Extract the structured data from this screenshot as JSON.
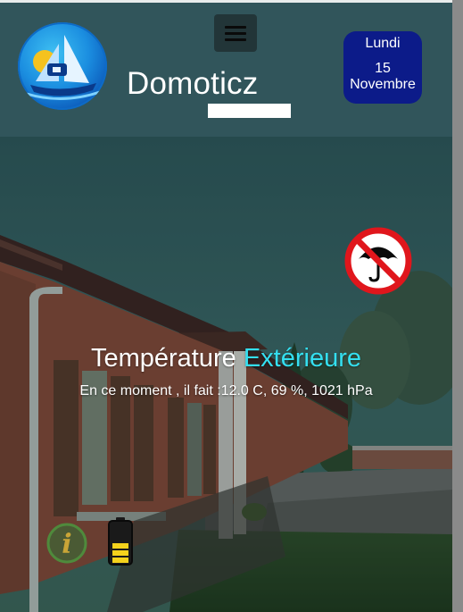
{
  "header": {
    "title": "Domoticz",
    "date": {
      "weekday": "Lundi",
      "day": "15",
      "month": "Novembre"
    }
  },
  "weather": {
    "title_main": "Température",
    "title_accent": "Extérieure",
    "current_line": "En ce moment , il fait :12.0 C, 69 %, 1021 hPa",
    "rain_status_icon": "no-rain-umbrella-icon"
  },
  "icons": {
    "logo": "domoticz-sailboat-logo",
    "menu": "hamburger-menu-icon",
    "info": "info-icon",
    "battery": "battery-icon"
  },
  "colors": {
    "header_bg": "#31555b",
    "date_badge_bg": "#0c1b89",
    "accent_text": "#34dff0",
    "no_rain_red": "#e0161c",
    "info_green": "#4f8a3c",
    "battery_yellow": "#f4d21c"
  },
  "battery_level": 0.6
}
